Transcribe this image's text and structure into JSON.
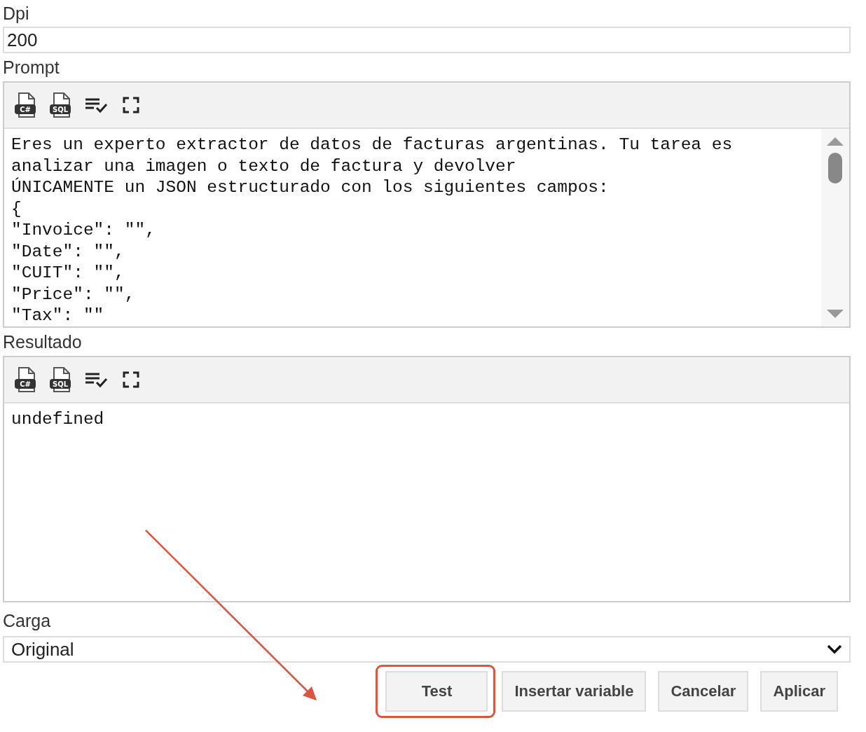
{
  "dpi": {
    "label": "Dpi",
    "value": "200"
  },
  "prompt": {
    "label": "Prompt",
    "scrollbar": true,
    "toolbar": [
      {
        "kind": "csharp",
        "label": "C#"
      },
      {
        "kind": "sql",
        "label": "SQL"
      },
      {
        "kind": "wrap"
      },
      {
        "kind": "fullscreen"
      }
    ],
    "lines": [
      "Eres un experto extractor de datos de facturas argentinas. Tu tarea es",
      "analizar una imagen o texto de factura y devolver",
      "ÚNICAMENTE un JSON estructurado con los siguientes campos:",
      "{",
      "\"Invoice\": \"\",",
      "\"Date\": \"\",",
      "\"CUIT\": \"\",",
      "\"Price\": \"\",",
      "\"Tax\": \"\""
    ]
  },
  "result": {
    "label": "Resultado",
    "toolbar": [
      {
        "kind": "csharp",
        "label": "C#"
      },
      {
        "kind": "sql",
        "label": "SQL"
      },
      {
        "kind": "wrap"
      },
      {
        "kind": "fullscreen"
      }
    ],
    "lines": [
      "undefined"
    ]
  },
  "carga": {
    "label": "Carga",
    "value": "Original"
  },
  "buttons": [
    {
      "label": "Test",
      "highlighted": true
    },
    {
      "label": "Insertar variable",
      "highlighted": false
    },
    {
      "label": "Cancelar",
      "highlighted": false
    },
    {
      "label": "Aplicar",
      "highlighted": false
    }
  ]
}
